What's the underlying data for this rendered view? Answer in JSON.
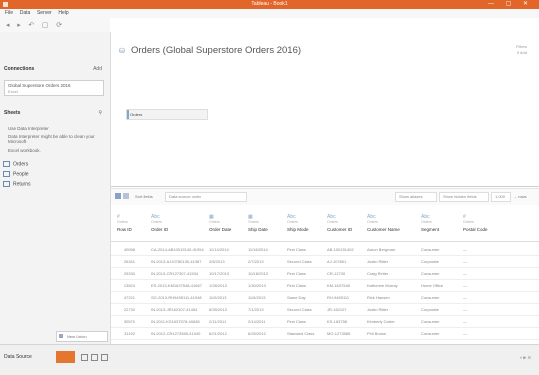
{
  "window": {
    "title": "Tableau - Book1"
  },
  "menu": [
    "File",
    "Data",
    "Server",
    "Help"
  ],
  "toolbar": [
    "◂",
    "▸",
    "↶",
    "▢",
    "⟳"
  ],
  "sidebar": {
    "connections_label": "Connections",
    "connections_add": "Add",
    "connection_name": "Global Superstore Orders 2016",
    "connection_type": "Excel",
    "sheets_label": "Sheets",
    "sheet_hint": "Use Data Interpreter",
    "sheet_hint2": "Data Interpreter might be able to clean your Microsoft",
    "sheet_hint3": "Excel workbook.",
    "sheets": [
      "Orders",
      "People",
      "Returns"
    ],
    "new_union": "New Union"
  },
  "main": {
    "title": "Orders (Global Superstore Orders 2016)",
    "filters_label": "Filters",
    "filters_value": "0 Add",
    "canvas_table": "Orders",
    "grid_sort_label": "Sort fields",
    "grid_sort_value": "Data source order",
    "show_aliases": "Show aliases",
    "show_hidden": "Show hidden fields",
    "rows_value": "1,000",
    "rows_suffix": "→ rows"
  },
  "columns": [
    {
      "type": "#",
      "src": "Orders",
      "name": "Row ID"
    },
    {
      "type": "Abc",
      "src": "Orders",
      "name": "Order ID"
    },
    {
      "type": "▦",
      "src": "Orders",
      "name": "Order Date"
    },
    {
      "type": "▦",
      "src": "Orders",
      "name": "Ship Date"
    },
    {
      "type": "Abc",
      "src": "Orders",
      "name": "Ship Mode"
    },
    {
      "type": "Abc",
      "src": "Orders",
      "name": "Customer ID"
    },
    {
      "type": "Abc",
      "src": "Orders",
      "name": "Customer Name"
    },
    {
      "type": "Abc",
      "src": "Orders",
      "name": "Segment"
    },
    {
      "type": "#",
      "src": "Orders",
      "name": "Postal Code"
    }
  ],
  "rows": [
    [
      "40098",
      "CA-2014-AB10015140-41954",
      "11/14/2014",
      "11/16/2014",
      "First Class",
      "AB-100151402",
      "Aaron Bergman",
      "Consumer",
      "—"
    ],
    [
      "26341",
      "IN-2013-AJ10780130-41367",
      "2/5/2013",
      "2/7/2013",
      "Second Class",
      "AJ-107801",
      "Justin Ritter",
      "Corporate",
      "—"
    ],
    [
      "25330",
      "IN-2013-CR127307-41534",
      "10/17/2013",
      "10/18/2013",
      "First Class",
      "CR-12730",
      "Craig Reiter",
      "Consumer",
      "—"
    ],
    [
      "13524",
      "ES-2013-KM1637548-41667",
      "1/28/2013",
      "1/30/2013",
      "First Class",
      "KM-1637548",
      "Katherine Murray",
      "Home Office",
      "—"
    ],
    [
      "47221",
      "SG-2013-RH9495111-41948",
      "11/5/2013",
      "11/6/2013",
      "Same Day",
      "RH-9495111",
      "Rick Hansen",
      "Consumer",
      "—"
    ],
    [
      "22732",
      "IN-2013-JR162107-41454",
      "6/28/2013",
      "7/1/2013",
      "Second Class",
      "JR-162107",
      "Justin Ritter",
      "Corporate",
      "—"
    ],
    [
      "30570",
      "IN-2011-KS1637578-40638",
      "2/11/2011",
      "2/14/2011",
      "First Class",
      "KS-163758",
      "Kimberly Carter",
      "Consumer",
      "—"
    ],
    [
      "31192",
      "IN-2012-CR1273585-41040",
      "6/21/2012",
      "6/25/2012",
      "Standard Class",
      "MG-1273585",
      "Phil Brown",
      "Consumer",
      "—"
    ]
  ],
  "statusbar": {
    "data_source": "Data Source",
    "right": "⏸ ▶ ⊞"
  },
  "colors": {
    "accent": "#e2662a",
    "active_tab": "#e4762f"
  }
}
